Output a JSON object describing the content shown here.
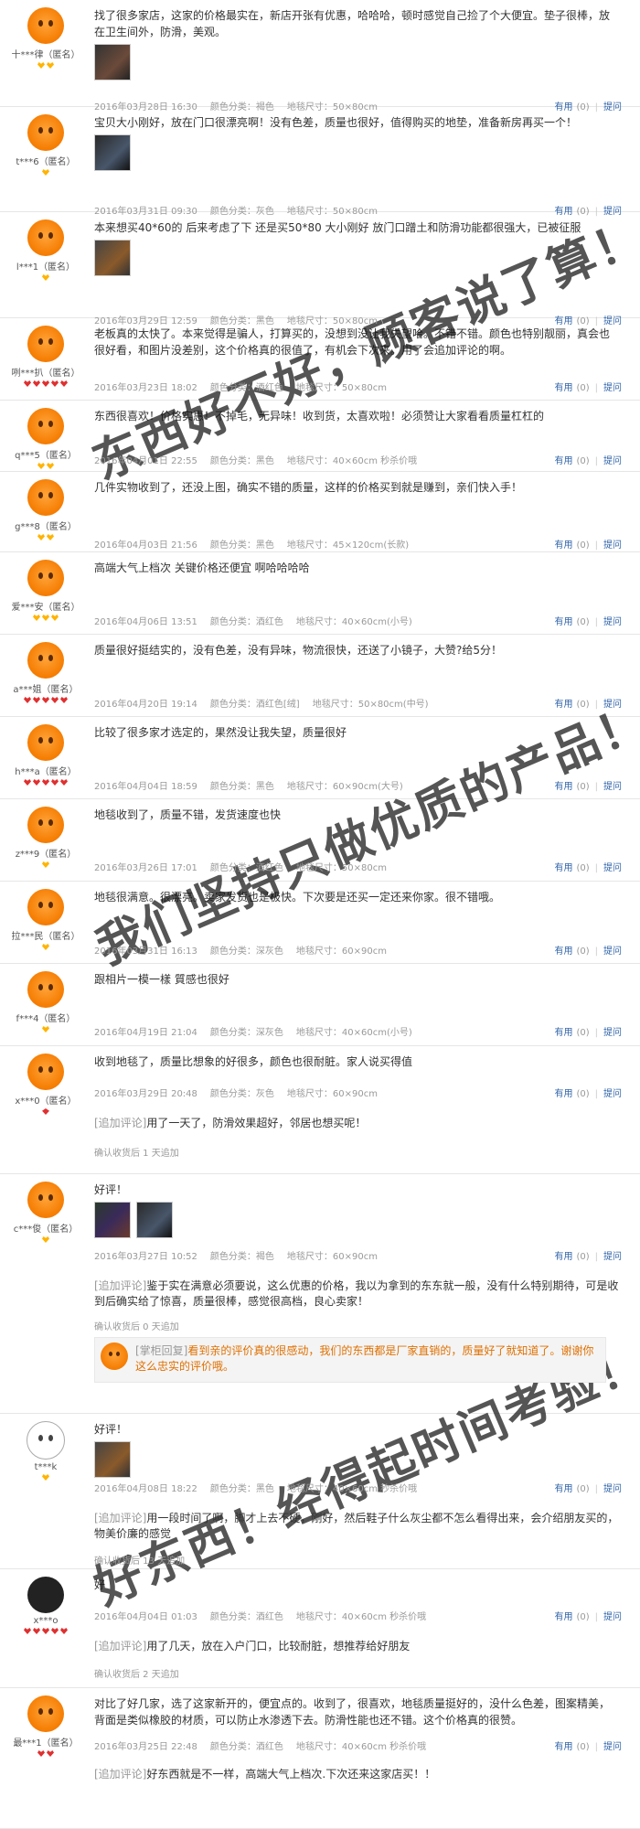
{
  "labels": {
    "color_prefix": "颜色分类：",
    "size_prefix": "地毯尺寸：",
    "useful": "有用",
    "useful_count": "(0)",
    "ask": "提问",
    "followup_label": "[追加评论]",
    "reply_label": "[掌柜回复]"
  },
  "reviews": [
    {
      "user": "十***律（匿名）",
      "badges": "heart:2",
      "text": "找了很多家店，这家的价格最实在，新店开张有优惠，哈哈哈，顿时感觉自己捡了个大便宜。垫子很棒，放在卫生间外，防滑，美观。",
      "thumbs": 1,
      "date": "2016年03月28日 16:30",
      "color": "褐色",
      "size": "50×80cm"
    },
    {
      "user": "t***6（匿名）",
      "badges": "heart:1",
      "text": "宝贝大小刚好，放在门口很漂亮啊！没有色差，质量也很好，值得购买的地垫，准备新房再买一个！",
      "thumbs": 1,
      "date": "2016年03月31日 09:30",
      "color": "灰色",
      "size": "50×80cm"
    },
    {
      "user": "l***1（匿名）",
      "badges": "heart:1",
      "text": "本来想买40*60的 后来考虑了下 还是买50*80 大小刚好 放门口蹭土和防滑功能都很强大，已被征服",
      "thumbs": 1,
      "date": "2016年03月29日 12:59",
      "color": "黑色",
      "size": "50×80cm"
    },
    {
      "user": "咧***扒（匿名）",
      "badges": "red:5",
      "text": "老板真的太快了。本来觉得是骗人，打算买的，没想到没让我失望哈。不错不错。颜色也特别靓丽，真会也很好看，和图片没差别，这个价格真的很值了，有机会下次来。用了会追加评论的啊。",
      "thumbs": 0,
      "date": "2016年03月23日 18:02",
      "color": "酒红色",
      "size": "50×80cm"
    },
    {
      "user": "q***5（匿名）",
      "badges": "heart:2",
      "text": "东西很喜欢！价格实惠！不掉毛，无异味！收到货，太喜欢啦！必须赞让大家看看质量杠杠的",
      "thumbs": 0,
      "date": "2016年04月01日 22:55",
      "color": "黑色",
      "size": "40×60cm 秒杀价哦"
    },
    {
      "user": "g***8（匿名）",
      "badges": "heart:2",
      "text": "几件实物收到了，还没上图，确实不错的质量，这样的价格买到就是赚到，亲们快入手！",
      "thumbs": 0,
      "date": "2016年04月03日 21:56",
      "color": "黑色",
      "size": "45×120cm(长款)"
    },
    {
      "user": "爱***安（匿名）",
      "badges": "heart:3",
      "text": "高端大气上档次 关键价格还便宜 啊哈哈哈哈",
      "thumbs": 0,
      "date": "2016年04月06日 13:51",
      "color": "酒红色",
      "size": "40×60cm(小号)"
    },
    {
      "user": "a***姐（匿名）",
      "badges": "red:5",
      "text": "质量很好挺结实的，没有色差，没有异味，物流很快，还送了小镜子，大赞?给5分！",
      "thumbs": 0,
      "date": "2016年04月20日 19:14",
      "color": "酒红色[绒]",
      "size": "50×80cm(中号)"
    },
    {
      "user": "h***a（匿名）",
      "badges": "red:5",
      "text": "比较了很多家才选定的，果然没让我失望，质量很好",
      "thumbs": 0,
      "date": "2016年04月04日 18:59",
      "color": "黑色",
      "size": "60×90cm(大号)"
    },
    {
      "user": "z***9（匿名）",
      "badges": "heart:1",
      "text": "地毯收到了，质量不错，发货速度也快",
      "thumbs": 0,
      "date": "2016年03月26日 17:01",
      "color": "酒红色",
      "size": "50×80cm"
    },
    {
      "user": "拉***民（匿名）",
      "badges": "heart:1",
      "text": "地毯很满意。很漂亮。卖家发货也是极快。下次要是还买一定还来你家。很不错哦。",
      "thumbs": 0,
      "date": "2016年03月31日 16:13",
      "color": "深灰色",
      "size": "60×90cm"
    },
    {
      "user": "f***4（匿名）",
      "badges": "heart:1",
      "text": "跟相片一模一樣 質感也很好",
      "thumbs": 0,
      "date": "2016年04月19日 21:04",
      "color": "深灰色",
      "size": "40×60cm(小号)"
    },
    {
      "user": "x***0（匿名）",
      "badges": "diamond:1",
      "text": "收到地毯了，质量比想象的好很多，颜色也很耐脏。家人说买得值",
      "thumbs": 0,
      "date": "2016年03月29日 20:48",
      "color": "灰色",
      "size": "60×90cm",
      "followup": "用了一天了，防滑效果超好，邻居也想买呢！",
      "followup_time": "确认收货后 1 天追加"
    },
    {
      "user": "c***俊（匿名）",
      "badges": "heart:1",
      "text": "好评！",
      "thumbs": 2,
      "date": "2016年03月27日 10:52",
      "color": "褐色",
      "size": "60×90cm",
      "followup": "鉴于实在满意必须要说，这么优惠的价格，我以为拿到的东东就一般，没有什么特别期待，可是收到后确实给了惊喜，质量很棒，感觉很高档，良心卖家！",
      "followup_time": "确认收货后 0 天追加",
      "reply": "看到亲的评价真的很感动，我们的东西都是厂家直销的，质量好了就知道了。谢谢你这么忠实的评价哦。"
    },
    {
      "user": "t***k",
      "badges": "heart:1",
      "text": "好评！",
      "thumbs": 1,
      "date": "2016年04月08日 18:22",
      "color": "黑色",
      "size": "40×60cm 秒杀价哦",
      "followup": "用一段时间了啊，脚才上去不硬，刚好，然后鞋子什么灰尘都不怎么看得出来，会介绍朋友买的，物美价廉的感觉",
      "followup_time": "确认收货后 13 天追加"
    },
    {
      "user": "x***o",
      "badges": "red:5",
      "text": "好",
      "thumbs": 0,
      "date": "2016年04月04日 01:03",
      "color": "酒红色",
      "size": "40×60cm 秒杀价哦",
      "followup": "用了几天，放在入户门口，比较耐脏，想推荐给好朋友",
      "followup_time": "确认收货后 2 天追加"
    },
    {
      "user": "最***1（匿名）",
      "badges": "red:2",
      "text": "对比了好几家，选了这家新开的，便宜点的。收到了，很喜欢，地毯质量挺好的，没什么色差，图案精美，背面是类似橡胶的材质，可以防止水渗透下去。防滑性能也还不错。这个价格真的很赞。",
      "thumbs": 0,
      "date": "2016年03月25日 22:48",
      "color": "酒红色",
      "size": "40×60cm 秒杀价哦",
      "followup": "好东西就是不一样，高端大气上档次.下次还来这家店买！！",
      "followup_time": ""
    }
  ],
  "watermarks": [
    "东西好不好，顾客说了算！",
    "我们坚持只做优质的产品！",
    "好东西！经得起时间考验！"
  ]
}
